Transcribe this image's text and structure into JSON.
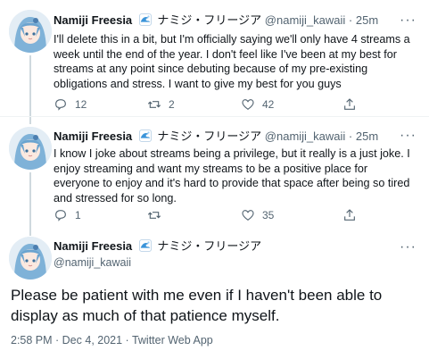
{
  "tweets": [
    {
      "display_name": "Namiji Freesia",
      "jp_name": "ナミジ・フリージア",
      "handle": "@namiji_kawaii",
      "separator": "·",
      "time": "25m",
      "more": "···",
      "text": "I'll delete this in a bit, but I'm officially saying we'll only have 4 streams a week until the end of the year. I don't feel like I've been at my best for streams at any point since debuting because of my pre-existing obligations and stress. I want to give my best for you guys",
      "replies": "12",
      "retweets": "2",
      "likes": "42"
    },
    {
      "display_name": "Namiji Freesia",
      "jp_name": "ナミジ・フリージア",
      "handle": "@namiji_kawaii",
      "separator": "·",
      "time": "25m",
      "more": "···",
      "text": "I know I joke about streams being a privilege, but it really is a just joke. I enjoy streaming and want my streams to be a positive place for everyone to enjoy and it's hard to provide that space after being so tired and stressed for so long.",
      "replies": "1",
      "retweets": "",
      "likes": "35"
    }
  ],
  "main_tweet": {
    "display_name": "Namiji Freesia",
    "jp_name": "ナミジ・フリージア",
    "handle": "@namiji_kawaii",
    "more": "···",
    "text": "Please be patient with me even if I haven't been able to display as much of that patience myself.",
    "meta": "2:58 PM · Dec 4, 2021 · Twitter Web App"
  },
  "icons": {
    "reply": "reply-icon",
    "retweet": "retweet-icon",
    "like": "heart-icon",
    "share": "share-icon",
    "emoji": "wave-emoji-icon"
  },
  "colors": {
    "text": "#0f1419",
    "secondary": "#536471",
    "line": "#cfd9de",
    "avatar_hair": "#7fb2d8"
  }
}
